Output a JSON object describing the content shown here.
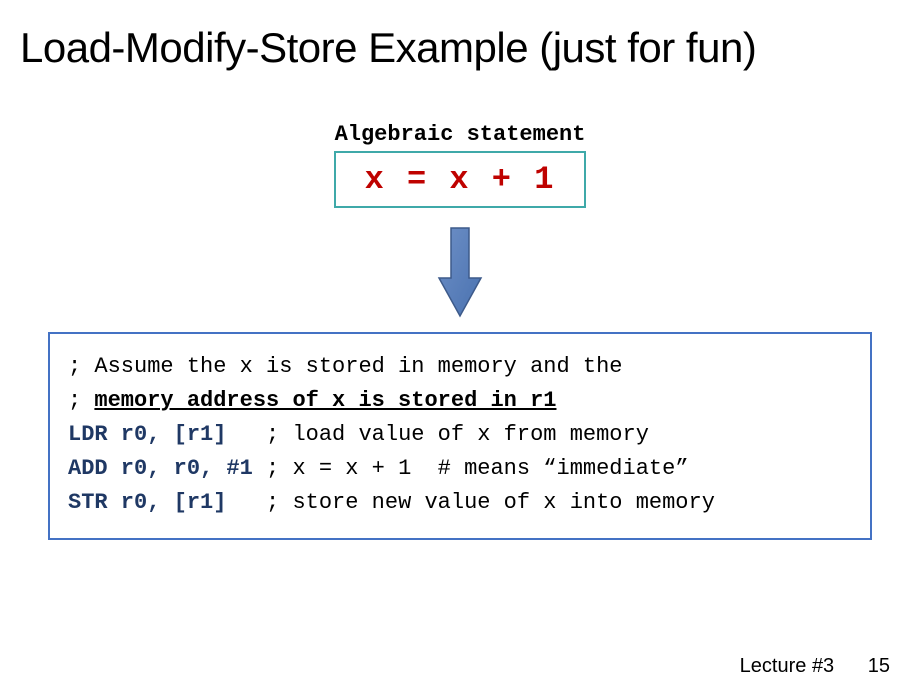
{
  "title": "Load-Modify-Store Example (just for fun)",
  "algebraic_label": "Algebraic statement",
  "equation": "x = x + 1",
  "code": {
    "comment1_prefix": "; Assume the x is stored in memory and the",
    "comment2_prefix": "; ",
    "comment2_underlined": "memory address of x is stored in r1",
    "instr1": "LDR r0, [r1]",
    "instr1_comment": "   ; load value of x from memory",
    "instr2": "ADD r0, r0, #1",
    "instr2_comment": " ; x = x + 1  # means “immediate”",
    "instr3": "STR r0, [r1]",
    "instr3_comment": "   ; store new value of x into memory"
  },
  "footer": {
    "lecture": "Lecture #3",
    "page": "15"
  }
}
